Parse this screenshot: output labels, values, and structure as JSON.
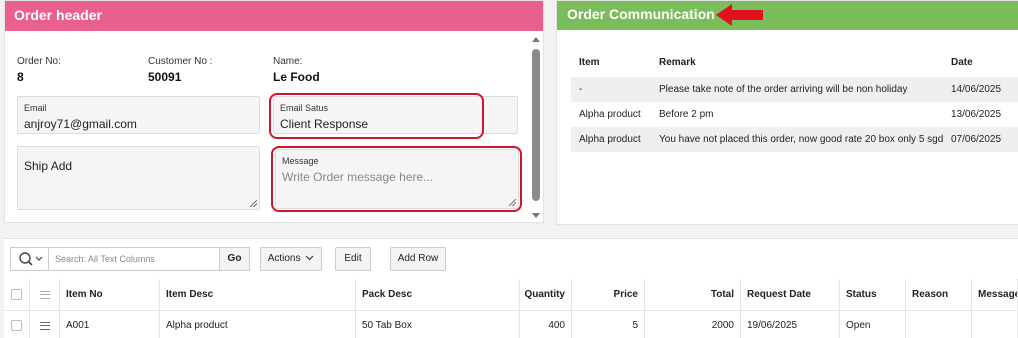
{
  "order_header": {
    "title": "Order header",
    "order_no_label": "Order No:",
    "order_no": "8",
    "customer_no_label": "Customer No :",
    "customer_no": "50091",
    "name_label": "Name:",
    "name": "Le Food",
    "email_label": "Email",
    "email": "anjroy71@gmail.com",
    "email_status_label": "Email Satus",
    "email_status": "Client Response",
    "ship_add_label": "Ship Add",
    "message_label": "Message",
    "message_placeholder": "Write Order message here..."
  },
  "order_communication": {
    "title": "Order Communication",
    "columns": [
      "Item",
      "Remark",
      "Date"
    ],
    "rows": [
      {
        "item": "-",
        "remark": "Please take note of the order arriving will be non holiday",
        "date": "14/06/2025"
      },
      {
        "item": "Alpha product",
        "remark": "Before 2 pm",
        "date": "13/06/2025"
      },
      {
        "item": "Alpha product",
        "remark": "You have not placed this order, now good rate 20 box only 5 sgd",
        "date": "07/06/2025"
      }
    ]
  },
  "toolbar": {
    "search_placeholder": "Search: All Text Columns",
    "go_label": "Go",
    "actions_label": "Actions",
    "edit_label": "Edit",
    "add_row_label": "Add Row"
  },
  "grid": {
    "columns": [
      "Item No",
      "Item Desc",
      "Pack Desc",
      "Quantity",
      "Price",
      "Total",
      "Request Date",
      "Status",
      "Reason",
      "Message"
    ],
    "rows": [
      {
        "item_no": "A001",
        "item_desc": "Alpha product",
        "pack_desc": "50 Tab Box",
        "quantity": "400",
        "price": "5",
        "total": "2000",
        "request_date": "19/06/2025",
        "status": "Open",
        "reason": "",
        "message": ""
      }
    ]
  },
  "colors": {
    "header_bar": "#e8608c",
    "communication_bar": "#7cbd5b",
    "highlight": "#d0142c"
  }
}
